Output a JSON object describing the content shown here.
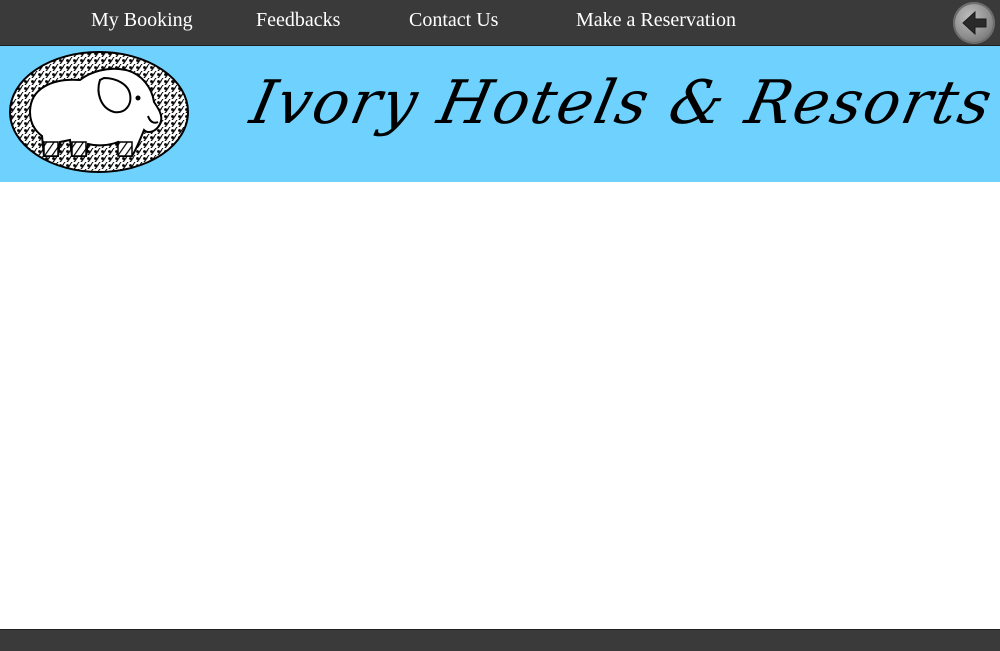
{
  "nav": {
    "items": [
      {
        "label": "My Booking"
      },
      {
        "label": "Feedbacks"
      },
      {
        "label": "Contact Us"
      },
      {
        "label": "Make a Reservation"
      }
    ],
    "back_icon": "back-arrow-icon"
  },
  "banner": {
    "title": "Ivory Hotels & Resorts",
    "logo_icon": "elephant-logo"
  },
  "colors": {
    "nav_bg": "#3a3a3a",
    "banner_bg": "#6fd2fe",
    "page_bg": "#ffffff",
    "nav_text": "#ffffff"
  }
}
